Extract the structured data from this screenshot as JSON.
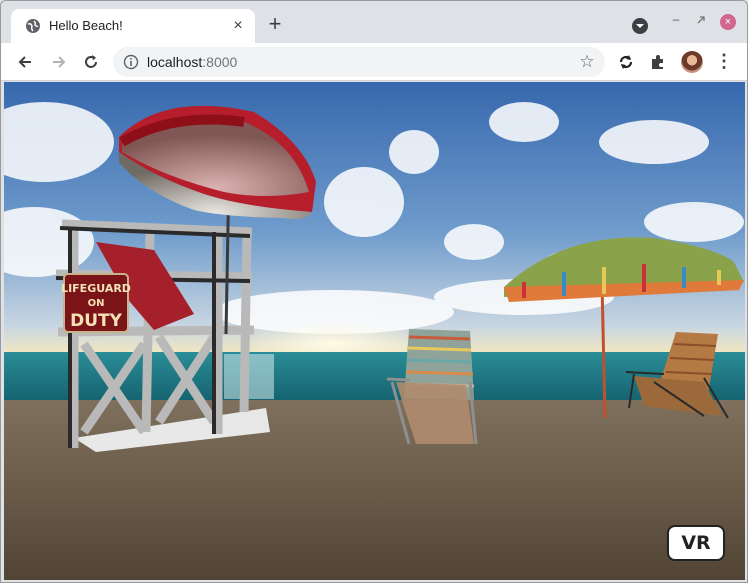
{
  "tab": {
    "title": "Hello Beach!",
    "close_glyph": "×"
  },
  "toolbar": {
    "new_tab_glyph": "+",
    "url_host": "localhost",
    "url_port": ":8000",
    "menu_glyph": "⋮",
    "star_glyph": "☆"
  },
  "window_controls": {
    "minimize_glyph": "–",
    "close_glyph": "×"
  },
  "scene": {
    "sign_line1": "LIFEGUARD",
    "sign_line2": "ON",
    "sign_line3": "DUTY"
  },
  "vr": {
    "label": "VR"
  },
  "colors": {
    "sky_top": "#3b6fb0",
    "sea": "#1f7d8a",
    "sand": "#6f5f4d",
    "umbrella_red": "#b0202a",
    "close_pink": "#d1668e"
  }
}
